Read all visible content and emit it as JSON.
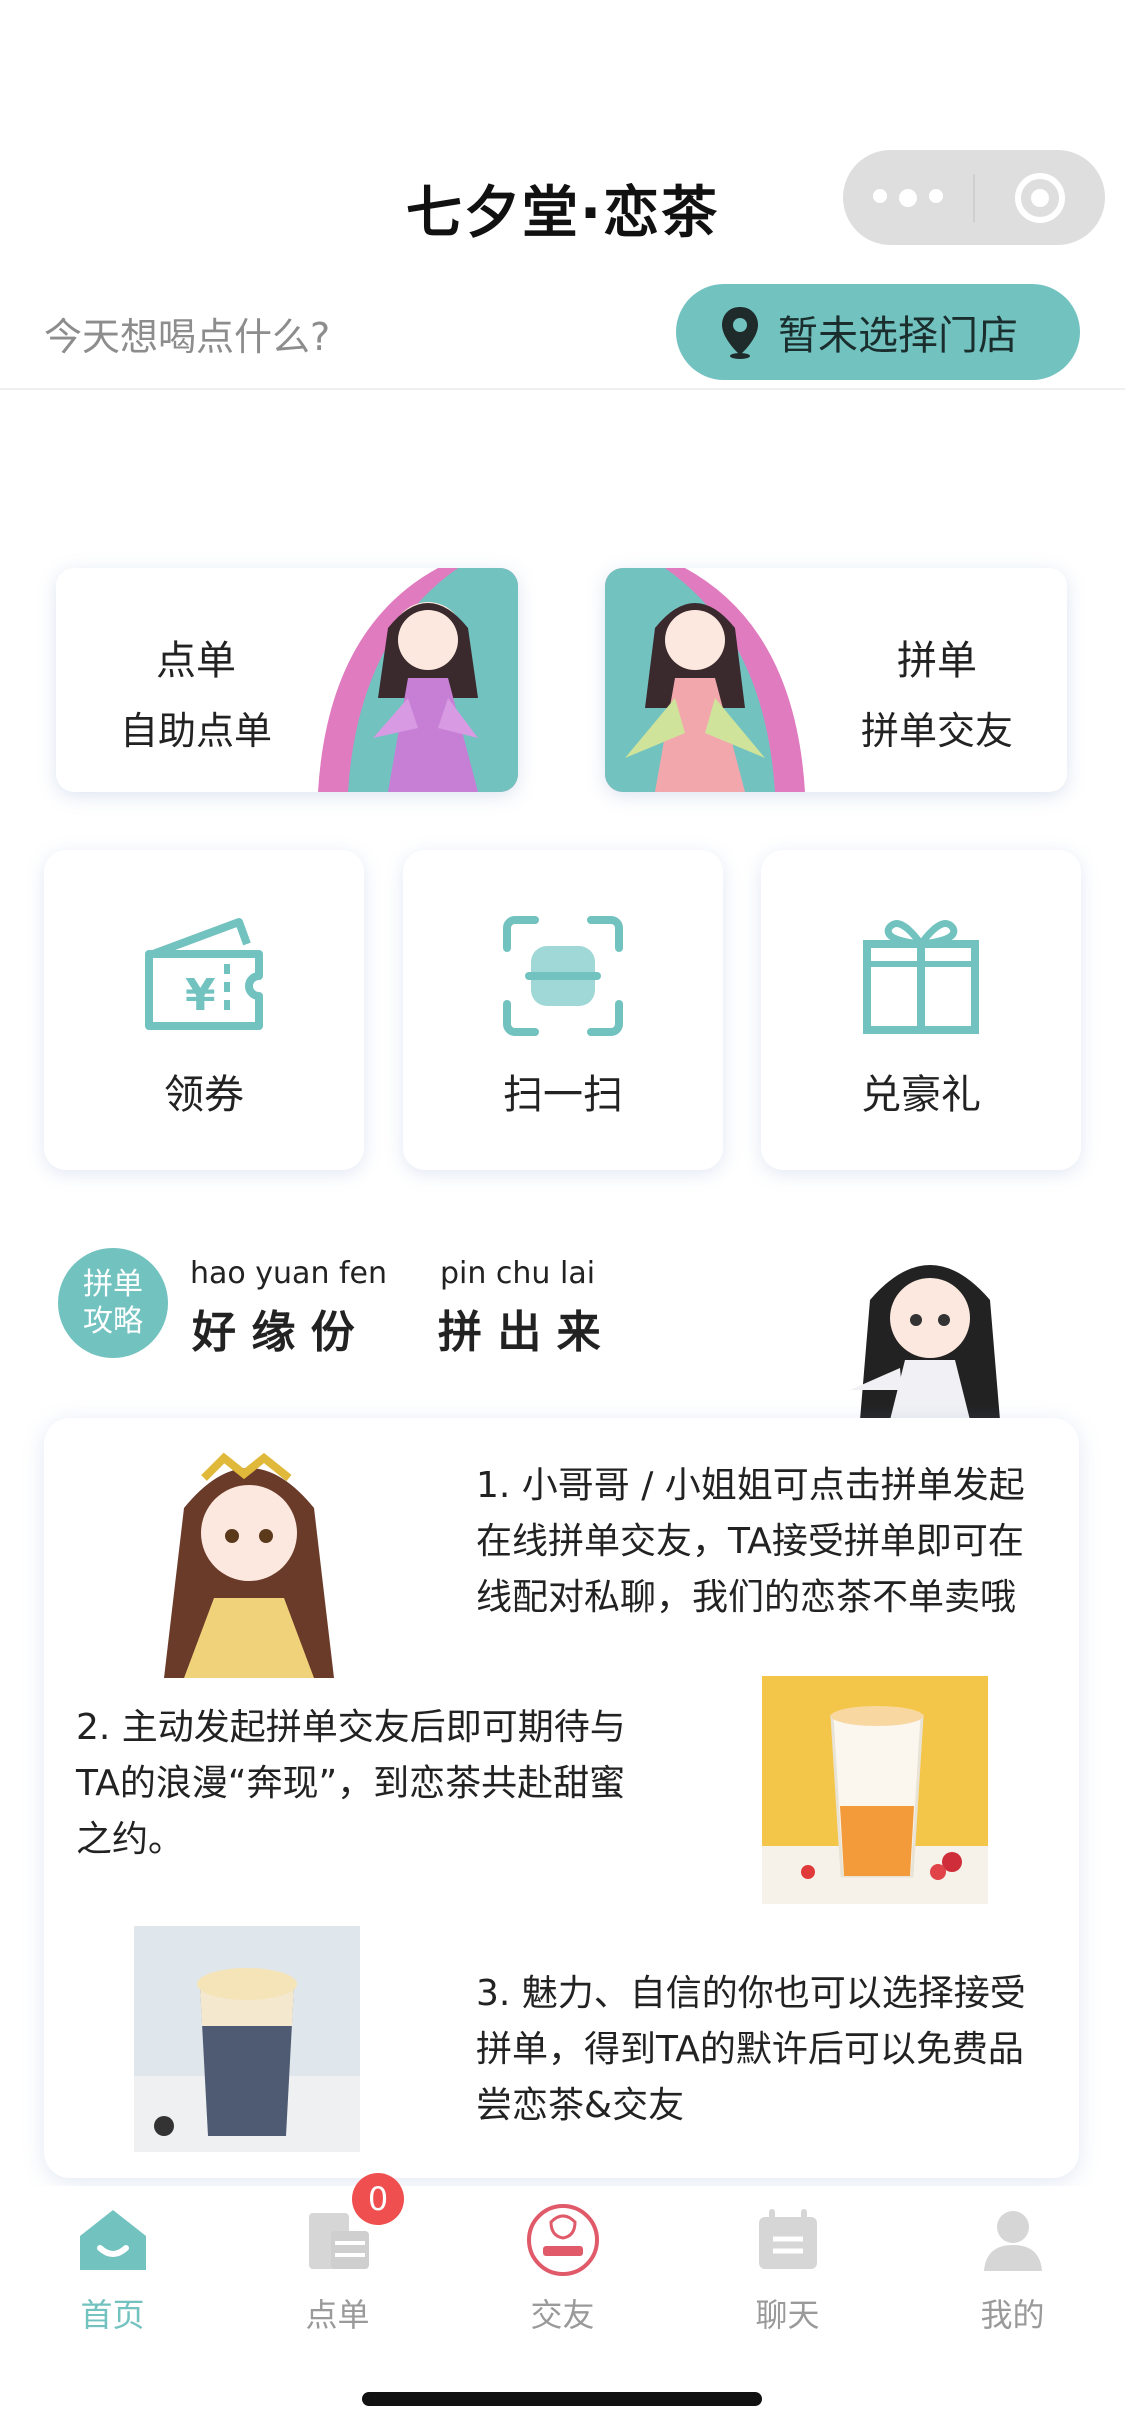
{
  "header": {
    "title": "七夕堂·恋茶"
  },
  "search": {
    "prompt": "今天想喝点什么?"
  },
  "store": {
    "label": "暂未选择门店"
  },
  "cards": [
    {
      "title": "点单",
      "subtitle": "自助点单"
    },
    {
      "title": "拼单",
      "subtitle": "拼单交友"
    }
  ],
  "tiles": [
    {
      "label": "领券",
      "icon": "coupon-icon"
    },
    {
      "label": "扫一扫",
      "icon": "scan-icon"
    },
    {
      "label": "兑豪礼",
      "icon": "gift-icon"
    }
  ],
  "strategy": {
    "badge": [
      "拼单",
      "攻略"
    ],
    "pinyin": [
      "hao yuan fen",
      "pin chu lai"
    ],
    "slogan": [
      "好 缘 份",
      "拼 出 来"
    ]
  },
  "steps": [
    "1. 小哥哥 / 小姐姐可点击拼单发起在线拼单交友，TA接受拼单即可在线配对私聊，我们的恋茶不单卖哦",
    "2. 主动发起拼单交友后即可期待与TA的浪漫“奔现”，到恋茶共赴甜蜜之约。",
    "3. 魅力、自信的你也可以选择接受拼单，得到TA的默许后可以免费品尝恋茶&交友"
  ],
  "nav": [
    {
      "label": "首页",
      "icon": "home-icon",
      "active": true
    },
    {
      "label": "点单",
      "icon": "order-icon",
      "active": false
    },
    {
      "label": "交友",
      "icon": "love-tea-logo-icon",
      "active": false
    },
    {
      "label": "聊天",
      "icon": "chat-icon",
      "active": false
    },
    {
      "label": "我的",
      "icon": "profile-icon",
      "active": false
    }
  ],
  "cart_count": "0",
  "colors": {
    "accent": "#72c2c0",
    "pink": "#e07bbf",
    "badge_red": "#f04f4f"
  }
}
